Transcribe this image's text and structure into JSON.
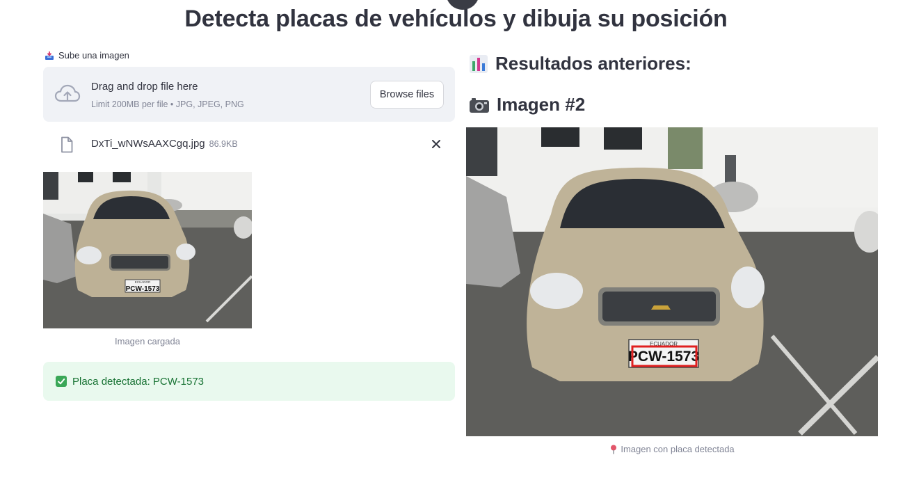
{
  "page": {
    "title": "Detecta placas de vehículos y dibuja su posición"
  },
  "uploader": {
    "label": "Sube una imagen",
    "drop_title": "Drag and drop file here",
    "limit_text": "Limit 200MB per file • JPG, JPEG, PNG",
    "browse_label": "Browse files",
    "file_name": "DxTi_wNWsAAXCgq.jpg",
    "file_size": "86.9KB"
  },
  "uploaded_image": {
    "caption": "Imagen cargada",
    "plate_text": "PCW-1573",
    "plate_header": "ECUADOR"
  },
  "result": {
    "success_message": "Placa detectada: PCW-1573"
  },
  "results_panel": {
    "heading": "Resultados anteriores:",
    "image_heading": "Imagen #2",
    "caption": "Imagen con placa detectada",
    "plate_text": "PCW-1573",
    "plate_header": "ECUADOR",
    "bbox_color": "#e02020"
  },
  "icons": {
    "uploader_label_icon": "inbox-tray-icon",
    "dropzone_icon": "cloud-upload-icon",
    "file_icon": "file-icon",
    "remove_icon": "close-icon",
    "success_icon": "check-box-icon",
    "results_icon": "bar-chart-icon",
    "image_icon": "camera-icon",
    "caption_icon": "pin-icon"
  },
  "colors": {
    "dropzone_bg": "#f0f2f6",
    "success_bg": "#e9f9ee",
    "success_text": "#177233",
    "muted_text": "#808495"
  }
}
